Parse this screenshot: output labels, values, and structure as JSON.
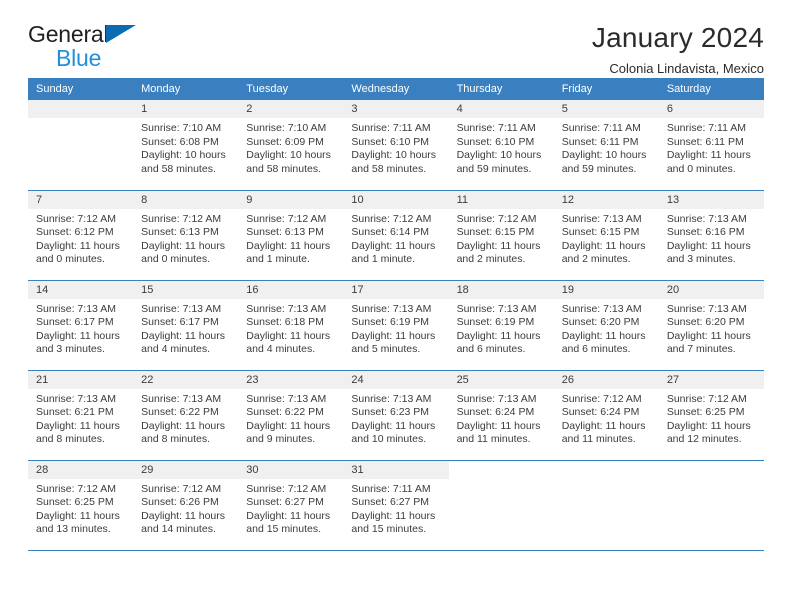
{
  "brand": {
    "name_part1": "General",
    "name_part2": "Blue",
    "triangle_color": "#0b6cb4",
    "blue_color": "#2090d8"
  },
  "header": {
    "title": "January 2024",
    "subtitle": "Colonia Lindavista, Mexico"
  },
  "theme": {
    "header_row_color": "#3a80c1",
    "daynum_bg": "#f0f0f0",
    "text_color": "#3c3c3c"
  },
  "weekday_headers": [
    "Sunday",
    "Monday",
    "Tuesday",
    "Wednesday",
    "Thursday",
    "Friday",
    "Saturday"
  ],
  "weeks": [
    [
      {
        "day": "",
        "sunrise": "",
        "sunset": "",
        "daylight_line1": "",
        "daylight_line2": "",
        "empty": true
      },
      {
        "day": "1",
        "sunrise": "Sunrise: 7:10 AM",
        "sunset": "Sunset: 6:08 PM",
        "daylight_line1": "Daylight: 10 hours",
        "daylight_line2": "and 58 minutes."
      },
      {
        "day": "2",
        "sunrise": "Sunrise: 7:10 AM",
        "sunset": "Sunset: 6:09 PM",
        "daylight_line1": "Daylight: 10 hours",
        "daylight_line2": "and 58 minutes."
      },
      {
        "day": "3",
        "sunrise": "Sunrise: 7:11 AM",
        "sunset": "Sunset: 6:10 PM",
        "daylight_line1": "Daylight: 10 hours",
        "daylight_line2": "and 58 minutes."
      },
      {
        "day": "4",
        "sunrise": "Sunrise: 7:11 AM",
        "sunset": "Sunset: 6:10 PM",
        "daylight_line1": "Daylight: 10 hours",
        "daylight_line2": "and 59 minutes."
      },
      {
        "day": "5",
        "sunrise": "Sunrise: 7:11 AM",
        "sunset": "Sunset: 6:11 PM",
        "daylight_line1": "Daylight: 10 hours",
        "daylight_line2": "and 59 minutes."
      },
      {
        "day": "6",
        "sunrise": "Sunrise: 7:11 AM",
        "sunset": "Sunset: 6:11 PM",
        "daylight_line1": "Daylight: 11 hours",
        "daylight_line2": "and 0 minutes."
      }
    ],
    [
      {
        "day": "7",
        "sunrise": "Sunrise: 7:12 AM",
        "sunset": "Sunset: 6:12 PM",
        "daylight_line1": "Daylight: 11 hours",
        "daylight_line2": "and 0 minutes."
      },
      {
        "day": "8",
        "sunrise": "Sunrise: 7:12 AM",
        "sunset": "Sunset: 6:13 PM",
        "daylight_line1": "Daylight: 11 hours",
        "daylight_line2": "and 0 minutes."
      },
      {
        "day": "9",
        "sunrise": "Sunrise: 7:12 AM",
        "sunset": "Sunset: 6:13 PM",
        "daylight_line1": "Daylight: 11 hours",
        "daylight_line2": "and 1 minute."
      },
      {
        "day": "10",
        "sunrise": "Sunrise: 7:12 AM",
        "sunset": "Sunset: 6:14 PM",
        "daylight_line1": "Daylight: 11 hours",
        "daylight_line2": "and 1 minute."
      },
      {
        "day": "11",
        "sunrise": "Sunrise: 7:12 AM",
        "sunset": "Sunset: 6:15 PM",
        "daylight_line1": "Daylight: 11 hours",
        "daylight_line2": "and 2 minutes."
      },
      {
        "day": "12",
        "sunrise": "Sunrise: 7:13 AM",
        "sunset": "Sunset: 6:15 PM",
        "daylight_line1": "Daylight: 11 hours",
        "daylight_line2": "and 2 minutes."
      },
      {
        "day": "13",
        "sunrise": "Sunrise: 7:13 AM",
        "sunset": "Sunset: 6:16 PM",
        "daylight_line1": "Daylight: 11 hours",
        "daylight_line2": "and 3 minutes."
      }
    ],
    [
      {
        "day": "14",
        "sunrise": "Sunrise: 7:13 AM",
        "sunset": "Sunset: 6:17 PM",
        "daylight_line1": "Daylight: 11 hours",
        "daylight_line2": "and 3 minutes."
      },
      {
        "day": "15",
        "sunrise": "Sunrise: 7:13 AM",
        "sunset": "Sunset: 6:17 PM",
        "daylight_line1": "Daylight: 11 hours",
        "daylight_line2": "and 4 minutes."
      },
      {
        "day": "16",
        "sunrise": "Sunrise: 7:13 AM",
        "sunset": "Sunset: 6:18 PM",
        "daylight_line1": "Daylight: 11 hours",
        "daylight_line2": "and 4 minutes."
      },
      {
        "day": "17",
        "sunrise": "Sunrise: 7:13 AM",
        "sunset": "Sunset: 6:19 PM",
        "daylight_line1": "Daylight: 11 hours",
        "daylight_line2": "and 5 minutes."
      },
      {
        "day": "18",
        "sunrise": "Sunrise: 7:13 AM",
        "sunset": "Sunset: 6:19 PM",
        "daylight_line1": "Daylight: 11 hours",
        "daylight_line2": "and 6 minutes."
      },
      {
        "day": "19",
        "sunrise": "Sunrise: 7:13 AM",
        "sunset": "Sunset: 6:20 PM",
        "daylight_line1": "Daylight: 11 hours",
        "daylight_line2": "and 6 minutes."
      },
      {
        "day": "20",
        "sunrise": "Sunrise: 7:13 AM",
        "sunset": "Sunset: 6:20 PM",
        "daylight_line1": "Daylight: 11 hours",
        "daylight_line2": "and 7 minutes."
      }
    ],
    [
      {
        "day": "21",
        "sunrise": "Sunrise: 7:13 AM",
        "sunset": "Sunset: 6:21 PM",
        "daylight_line1": "Daylight: 11 hours",
        "daylight_line2": "and 8 minutes."
      },
      {
        "day": "22",
        "sunrise": "Sunrise: 7:13 AM",
        "sunset": "Sunset: 6:22 PM",
        "daylight_line1": "Daylight: 11 hours",
        "daylight_line2": "and 8 minutes."
      },
      {
        "day": "23",
        "sunrise": "Sunrise: 7:13 AM",
        "sunset": "Sunset: 6:22 PM",
        "daylight_line1": "Daylight: 11 hours",
        "daylight_line2": "and 9 minutes."
      },
      {
        "day": "24",
        "sunrise": "Sunrise: 7:13 AM",
        "sunset": "Sunset: 6:23 PM",
        "daylight_line1": "Daylight: 11 hours",
        "daylight_line2": "and 10 minutes."
      },
      {
        "day": "25",
        "sunrise": "Sunrise: 7:13 AM",
        "sunset": "Sunset: 6:24 PM",
        "daylight_line1": "Daylight: 11 hours",
        "daylight_line2": "and 11 minutes."
      },
      {
        "day": "26",
        "sunrise": "Sunrise: 7:12 AM",
        "sunset": "Sunset: 6:24 PM",
        "daylight_line1": "Daylight: 11 hours",
        "daylight_line2": "and 11 minutes."
      },
      {
        "day": "27",
        "sunrise": "Sunrise: 7:12 AM",
        "sunset": "Sunset: 6:25 PM",
        "daylight_line1": "Daylight: 11 hours",
        "daylight_line2": "and 12 minutes."
      }
    ],
    [
      {
        "day": "28",
        "sunrise": "Sunrise: 7:12 AM",
        "sunset": "Sunset: 6:25 PM",
        "daylight_line1": "Daylight: 11 hours",
        "daylight_line2": "and 13 minutes."
      },
      {
        "day": "29",
        "sunrise": "Sunrise: 7:12 AM",
        "sunset": "Sunset: 6:26 PM",
        "daylight_line1": "Daylight: 11 hours",
        "daylight_line2": "and 14 minutes."
      },
      {
        "day": "30",
        "sunrise": "Sunrise: 7:12 AM",
        "sunset": "Sunset: 6:27 PM",
        "daylight_line1": "Daylight: 11 hours",
        "daylight_line2": "and 15 minutes."
      },
      {
        "day": "31",
        "sunrise": "Sunrise: 7:11 AM",
        "sunset": "Sunset: 6:27 PM",
        "daylight_line1": "Daylight: 11 hours",
        "daylight_line2": "and 15 minutes."
      },
      {
        "day": "",
        "sunrise": "",
        "sunset": "",
        "daylight_line1": "",
        "daylight_line2": "",
        "blank": true
      },
      {
        "day": "",
        "sunrise": "",
        "sunset": "",
        "daylight_line1": "",
        "daylight_line2": "",
        "blank": true
      },
      {
        "day": "",
        "sunrise": "",
        "sunset": "",
        "daylight_line1": "",
        "daylight_line2": "",
        "blank": true
      }
    ]
  ]
}
